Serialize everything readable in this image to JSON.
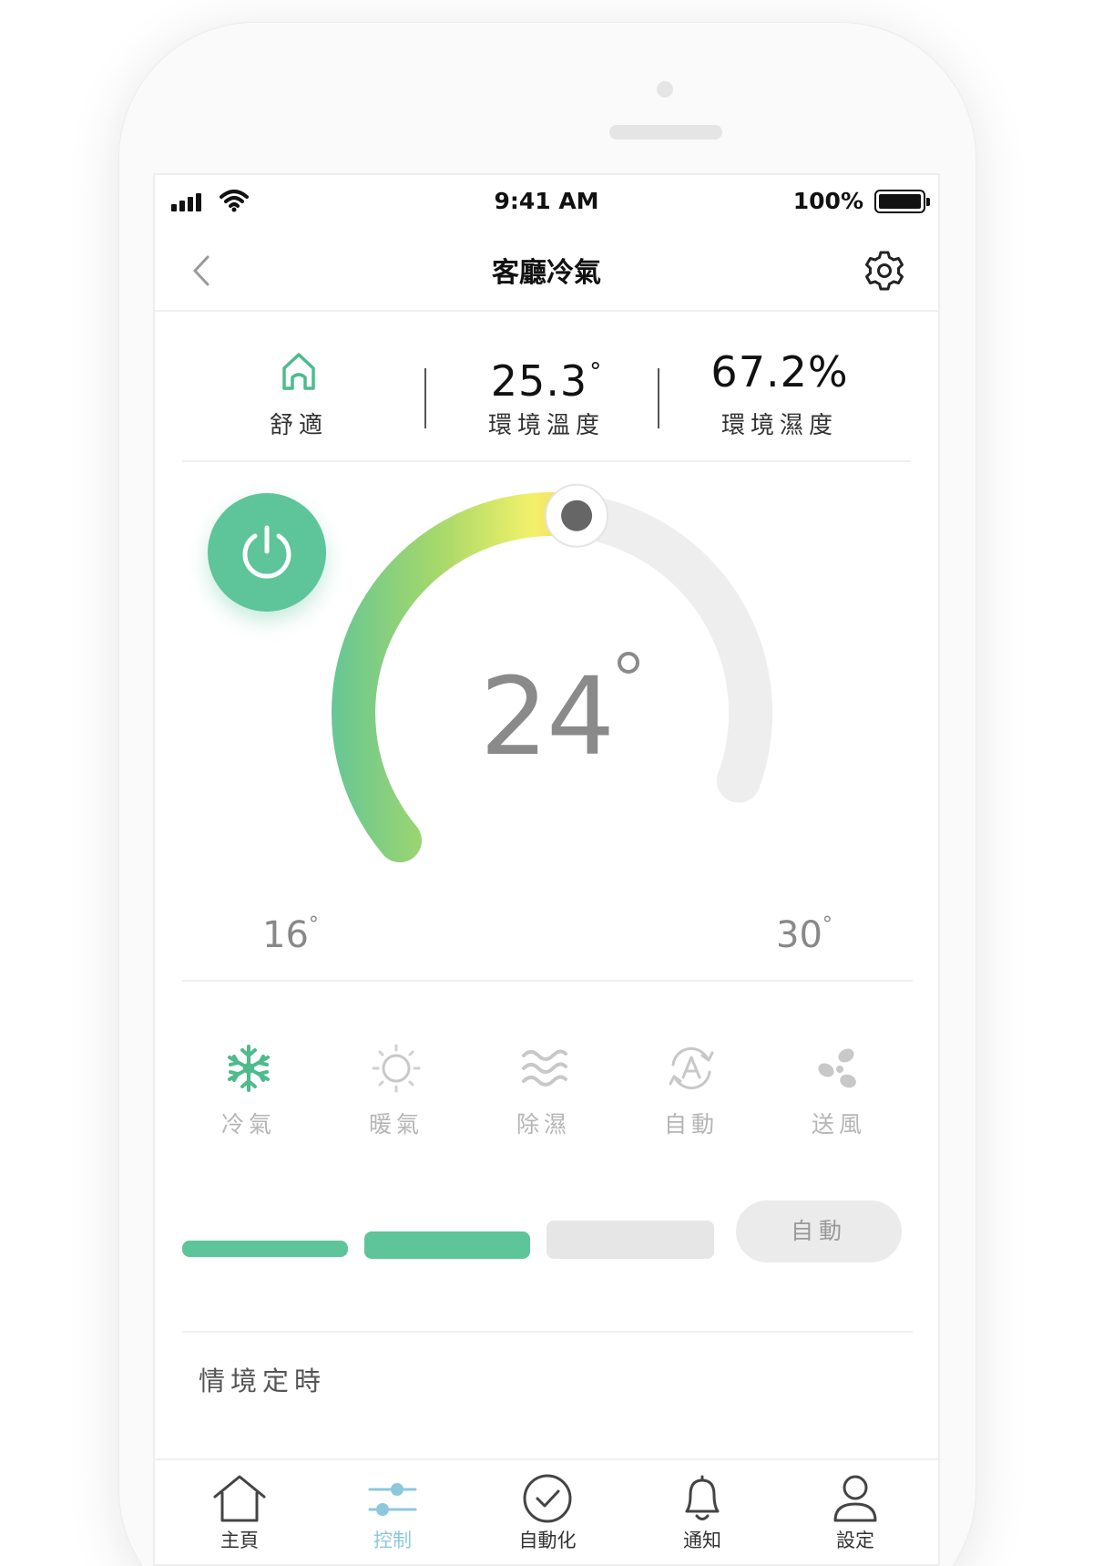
{
  "status_bar": {
    "time": "9:41 AM",
    "battery": "100%"
  },
  "header": {
    "title": "客廳冷氣"
  },
  "info": {
    "comfort_label": "舒適",
    "temperature_value": "25.3",
    "temperature_unit": "°",
    "temperature_label": "環境溫度",
    "humidity_value": "67.2%",
    "humidity_label": "環境濕度"
  },
  "thermostat": {
    "setpoint": "24",
    "min": "16",
    "max": "30",
    "degree": "°",
    "gradient_colors": [
      "#5ec49a",
      "#a6d86a",
      "#f3f16a",
      "#f3a75c",
      "#ee5c6e"
    ],
    "track_color": "#eeeeee"
  },
  "modes": [
    {
      "label": "冷氣",
      "icon": "snowflake-icon",
      "active": true
    },
    {
      "label": "暖氣",
      "icon": "sun-icon",
      "active": false
    },
    {
      "label": "除濕",
      "icon": "waves-icon",
      "active": false
    },
    {
      "label": "自動",
      "icon": "auto-cycle-icon",
      "active": false
    },
    {
      "label": "送風",
      "icon": "fan-icon",
      "active": false
    }
  ],
  "fan_speed": {
    "level": 2,
    "total_levels": 3,
    "auto_label": "自動"
  },
  "scene": {
    "label": "情境定時"
  },
  "tabs": [
    {
      "label": "主頁",
      "icon": "home-icon",
      "active": false
    },
    {
      "label": "控制",
      "icon": "sliders-icon",
      "active": true
    },
    {
      "label": "自動化",
      "icon": "check-circle-icon",
      "active": false
    },
    {
      "label": "通知",
      "icon": "bell-icon",
      "active": false
    },
    {
      "label": "設定",
      "icon": "user-icon",
      "active": false
    }
  ],
  "colors": {
    "accent": "#5ec49a",
    "inactive": "#e6e6e6",
    "tab_active": "#8cc8dc"
  }
}
